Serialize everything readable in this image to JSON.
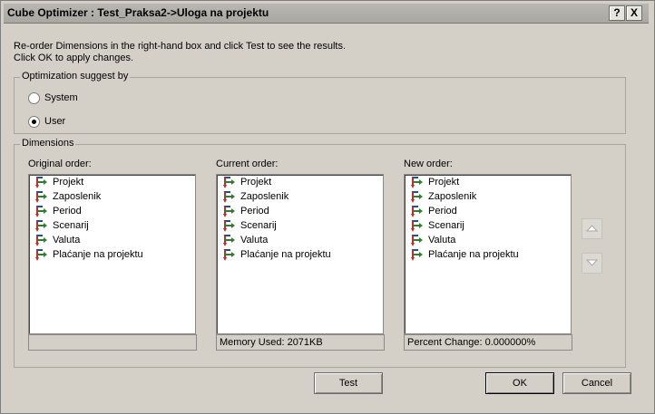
{
  "window": {
    "title": "Cube Optimizer : Test_Praksa2->Uloga na projektu"
  },
  "titlebar_buttons": {
    "help": "?",
    "close": "X"
  },
  "description": {
    "line1": "Re-order Dimensions in the right-hand box and click Test to see the results.",
    "line2": "Click OK to apply changes."
  },
  "optimization": {
    "legend": "Optimization suggest by",
    "options": [
      {
        "label": "System",
        "selected": false
      },
      {
        "label": "User",
        "selected": true
      }
    ]
  },
  "dimensions": {
    "legend": "Dimensions",
    "original": {
      "label": "Original order:",
      "items": [
        "Projekt",
        "Zaposlenik",
        "Period",
        "Scenarij",
        "Valuta",
        "Plaćanje na projektu"
      ],
      "status": ""
    },
    "current": {
      "label": "Current order:",
      "items": [
        "Projekt",
        "Zaposlenik",
        "Period",
        "Scenarij",
        "Valuta",
        "Plaćanje na projektu"
      ],
      "status": "Memory Used: 2071KB"
    },
    "new": {
      "label": "New order:",
      "items": [
        "Projekt",
        "Zaposlenik",
        "Period",
        "Scenarij",
        "Valuta",
        "Plaćanje na projektu"
      ],
      "status": "Percent Change: 0.000000%"
    }
  },
  "buttons": {
    "test": "Test",
    "ok": "OK",
    "cancel": "Cancel"
  },
  "icons": {
    "dimension": "dimension-hierarchy-icon",
    "move_up": "triangle-up-icon",
    "move_down": "triangle-down-icon"
  },
  "colors": {
    "icon_green": "#2e7d32",
    "icon_red": "#c62828",
    "icon_blue": "#1f4fa0"
  }
}
